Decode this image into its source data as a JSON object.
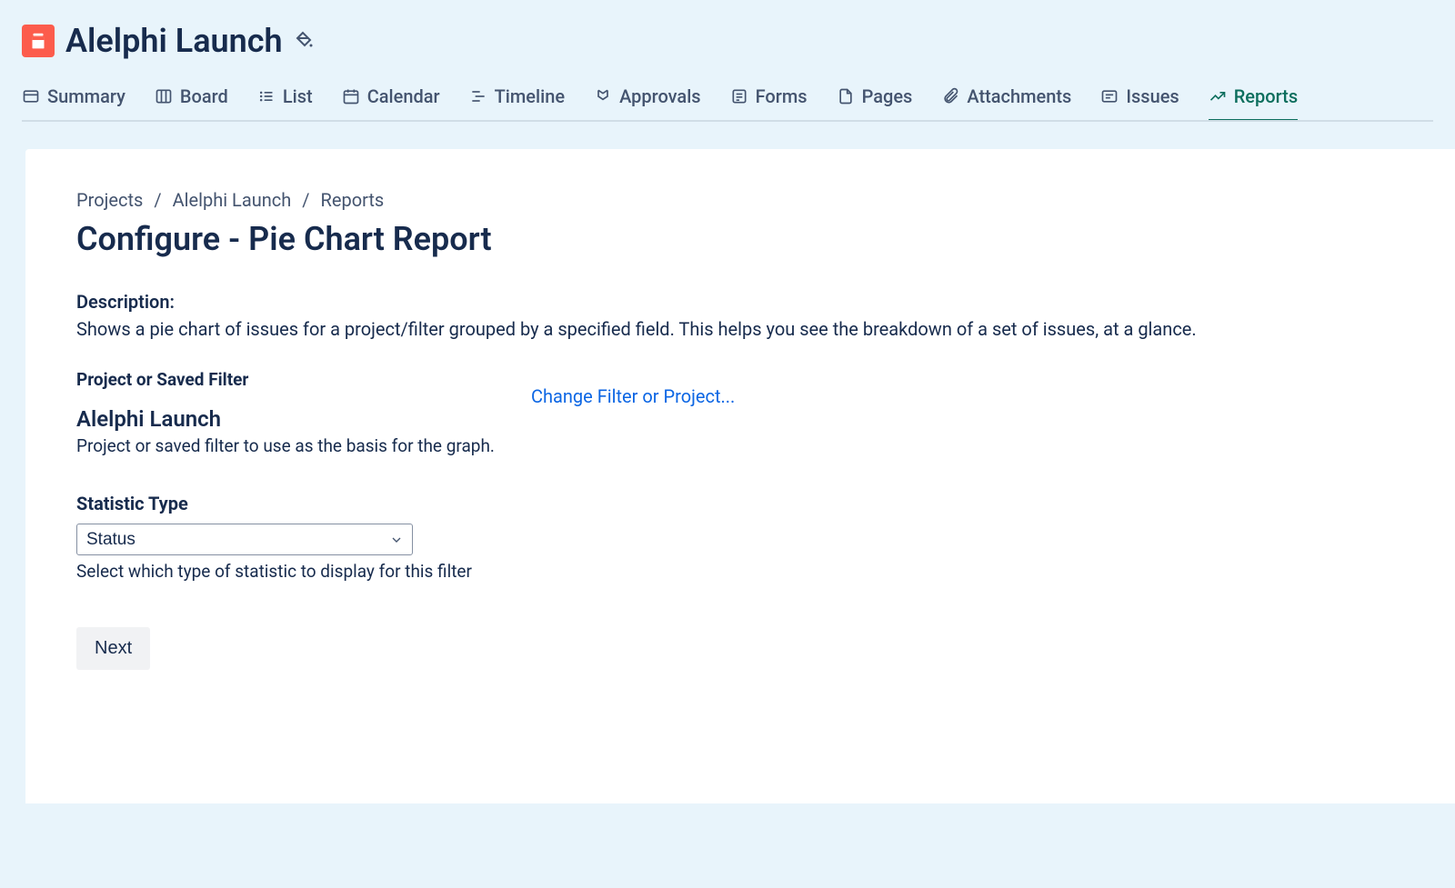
{
  "header": {
    "project_name": "Alelphi Launch"
  },
  "tabs": [
    {
      "label": "Summary",
      "icon": "summary"
    },
    {
      "label": "Board",
      "icon": "board"
    },
    {
      "label": "List",
      "icon": "list"
    },
    {
      "label": "Calendar",
      "icon": "calendar"
    },
    {
      "label": "Timeline",
      "icon": "timeline"
    },
    {
      "label": "Approvals",
      "icon": "approvals"
    },
    {
      "label": "Forms",
      "icon": "forms"
    },
    {
      "label": "Pages",
      "icon": "pages"
    },
    {
      "label": "Attachments",
      "icon": "attachments"
    },
    {
      "label": "Issues",
      "icon": "issues"
    },
    {
      "label": "Reports",
      "icon": "reports",
      "active": true
    }
  ],
  "breadcrumbs": {
    "items": [
      "Projects",
      "Alelphi Launch",
      "Reports"
    ]
  },
  "page": {
    "title": "Configure - Pie Chart Report",
    "description_label": "Description:",
    "description_text": "Shows a pie chart of issues for a project/filter grouped by a specified field. This helps you see the breakdown of a set of issues, at a glance.",
    "filter_label": "Project or Saved Filter",
    "change_filter_link": "Change Filter or Project...",
    "selected_project": "Alelphi Launch",
    "filter_help": "Project or saved filter to use as the basis for the graph.",
    "stat_label": "Statistic Type",
    "stat_selected": "Status",
    "stat_help": "Select which type of statistic to display for this filter",
    "next_button": "Next"
  }
}
